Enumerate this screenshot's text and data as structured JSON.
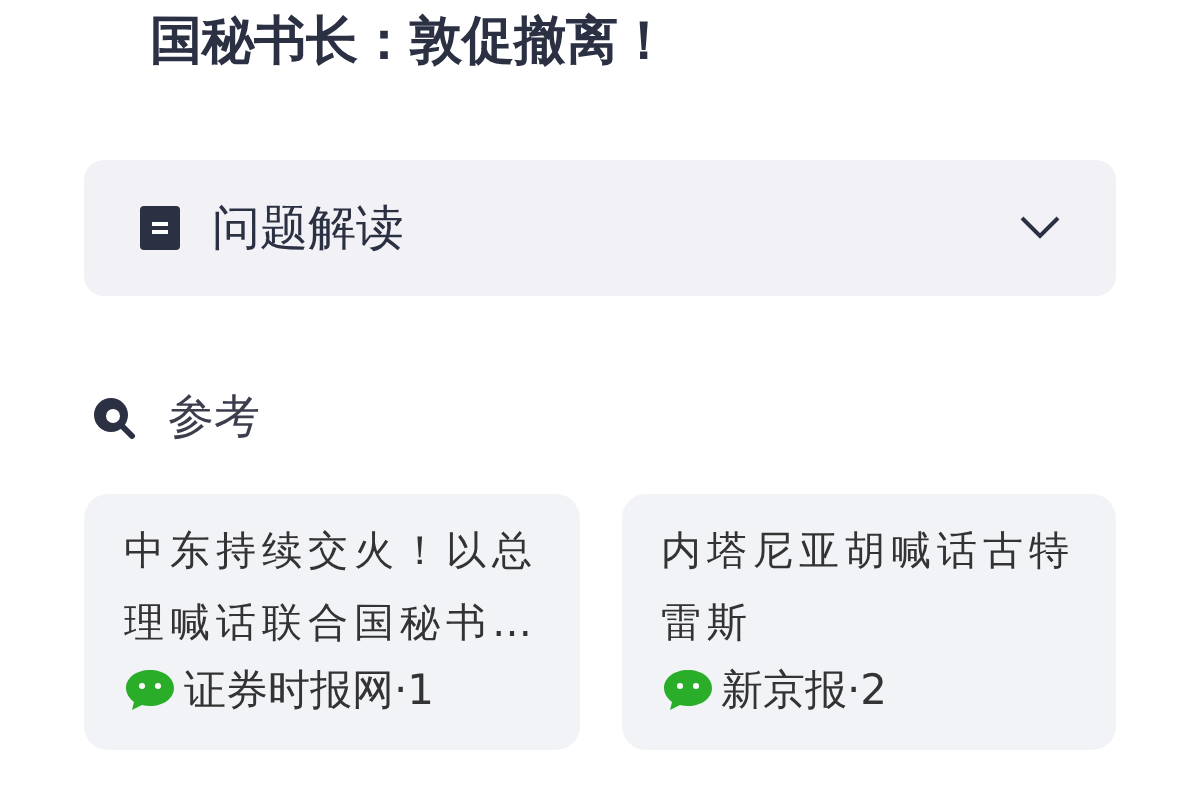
{
  "title": "国秘书长：敦促撤离！",
  "accordion": {
    "label": "问题解读",
    "expanded": false
  },
  "references": {
    "heading": "参考",
    "cards": [
      {
        "text": "中东持续交火！以总理喊话联合国秘书…",
        "source": "证券时报网·1"
      },
      {
        "text": "内塔尼亚胡喊话古特雷斯",
        "source": "新京报·2"
      }
    ]
  }
}
